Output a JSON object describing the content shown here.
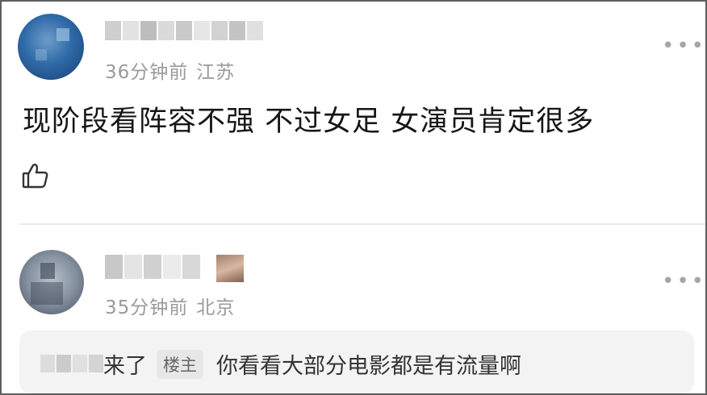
{
  "comments": [
    {
      "time": "36分钟前",
      "location": "江苏",
      "content": "现阶段看阵容不强  不过女足 女演员肯定很多",
      "more_label": "•••",
      "like_icon": "thumbs-up-icon"
    },
    {
      "time": "35分钟前",
      "location": "北京",
      "more_label": "•••",
      "reply": {
        "action": "来了",
        "op_tag": "楼主",
        "text": "你看看大部分电影都是有流量啊"
      }
    }
  ]
}
